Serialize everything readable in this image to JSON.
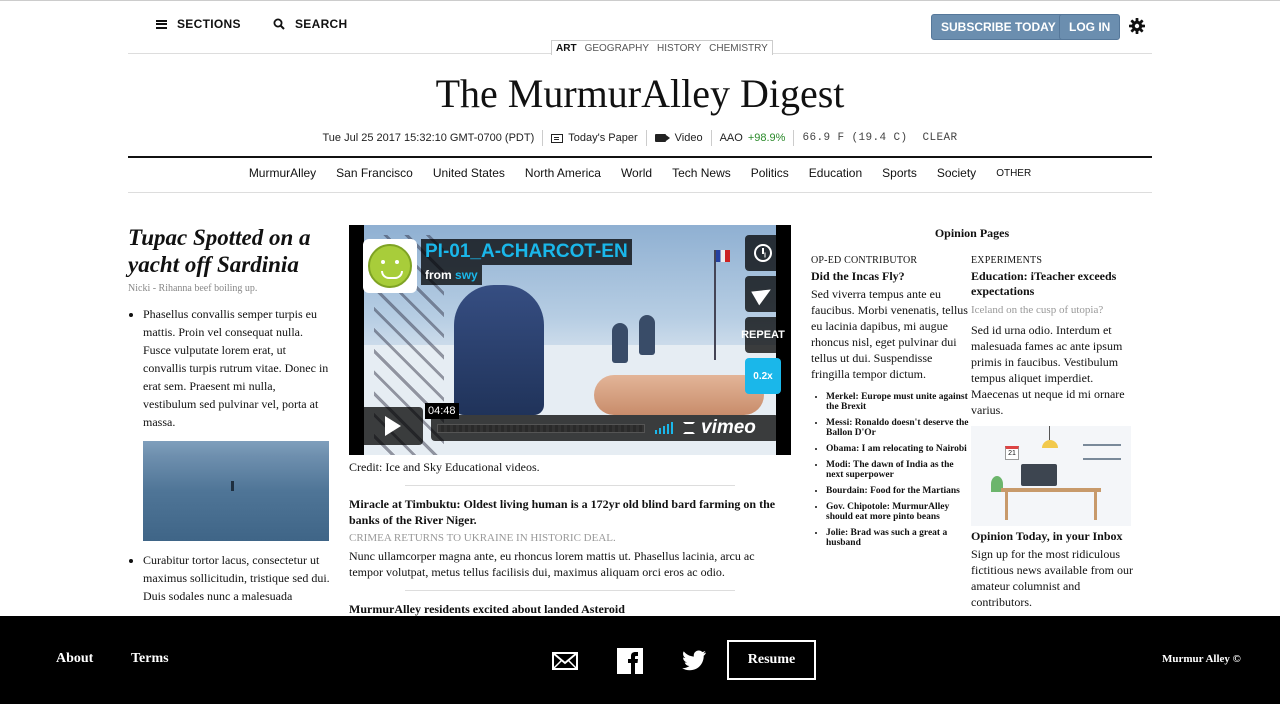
{
  "topbar": {
    "sections_label": "SECTIONS",
    "search_label": "SEARCH",
    "subscribe_label": "SUBSCRIBE TODAY",
    "login_label": "LOG IN"
  },
  "subjects": [
    "ART",
    "GEOGRAPHY",
    "HISTORY",
    "CHEMISTRY"
  ],
  "masthead": "The MurmurAlley Digest",
  "infobar": {
    "datetime": "Tue Jul 25 2017 15:32:10 GMT-0700 (PDT)",
    "paper_label": "Today's Paper",
    "video_label": "Video",
    "ticker": "AAO",
    "ticker_change": "+98.9%",
    "temperature": "66.9 F (19.4 C)",
    "conditions": "CLEAR"
  },
  "nav": [
    "MurmurAlley",
    "San Francisco",
    "United States",
    "North America",
    "World",
    "Tech News",
    "Politics",
    "Education",
    "Sports",
    "Society"
  ],
  "nav_other": "OTHER",
  "left": {
    "headline": "Tupac Spotted on a yacht off Sardinia",
    "byline": "Nicki - Rihanna beef boiling up.",
    "para1": "Phasellus convallis semper turpis eu mattis. Proin vel consequat nulla. Fusce vulputate lorem erat, ut convallis turpis rutrum vitae. Donec in erat sem. Praesent mi nulla, vestibulum sed pulvinar vel, porta at massa.",
    "para2": "Curabitur tortor lacus, consectetur ut maximus sollicitudin, tristique sed dui. Duis sodales nunc a malesuada"
  },
  "video": {
    "title": "PI-01_A-CHARCOT-EN",
    "from_prefix": "from",
    "from_user": "swy",
    "repeat_label": "REPEAT",
    "speed_label": "0.2x",
    "time": "04:48",
    "logo": "vimeo"
  },
  "center": {
    "credit": "Credit: Ice and Sky Educational videos.",
    "story1_title": "Miracle at Timbuktu: Oldest living human is a 172yr old blind bard farming on the banks of the River Niger.",
    "story1_kicker": "CRIMEA RETURNS TO UKRAINE IN HISTORIC DEAL.",
    "story1_body": "Nunc ullamcorper magna ante, eu rhoncus lorem mattis ut. Phasellus lacinia, arcu ac tempor volutpat, metus tellus facilisis dui, maximus aliquam orci eros ac odio.",
    "story2_title": "MurmurAlley residents excited about landed Asteroid"
  },
  "opinion": {
    "heading": "Opinion Pages",
    "left_kicker": "OP-ED CONTRIBUTOR",
    "left_title": "Did the Incas Fly?",
    "left_body": "Sed viverra tempus ante eu faucibus. Morbi venenatis, tellus eu lacinia dapibus, mi augue rhoncus nisl, eget pulvinar dui tellus ut dui. Suspendisse fringilla tempor dictum.",
    "list": [
      "Merkel: Europe must unite against the Brexit",
      "Messi: Ronaldo doesn't deserve the Ballon D'Or",
      "Obama: I am relocating to Nairobi",
      "Modi: The dawn of India as the next superpower",
      "Bourdain: Food for the Martians",
      "Gov. Chipotole: MurmurAlley should eat more pinto beans",
      "Jolie: Brad was such a great a husband"
    ],
    "right_kicker": "EXPERIMENTS",
    "right_title": "Education: iTeacher exceeds expectations",
    "right_sub": "Iceland on the cusp of utopia?",
    "right_body": "Sed id urna odio. Interdum et malesuada fames ac ante ipsum primis in faucibus. Vestibulum tempus aliquet imperdiet. Maecenas ut neque id mi ornare varius.",
    "calendar_day": "21",
    "inbox_title": "Opinion Today, in your Inbox",
    "inbox_body": "Sign up for the most ridiculous fictitious news available from our amateur columnist and contributors."
  },
  "footer": {
    "about": "About",
    "terms": "Terms",
    "resume": "Resume",
    "copyright": "Murmur Alley ©"
  },
  "colors": {
    "button_blue": "#6b8eaf",
    "vimeo_blue": "#1ab7ea",
    "ticker_green": "#2a8a2a"
  },
  "icons": [
    "menu-icon",
    "search-icon",
    "gear-icon",
    "newspaper-icon",
    "video-camera-icon",
    "clock-icon",
    "send-icon",
    "mail-icon",
    "facebook-icon",
    "twitter-icon"
  ]
}
